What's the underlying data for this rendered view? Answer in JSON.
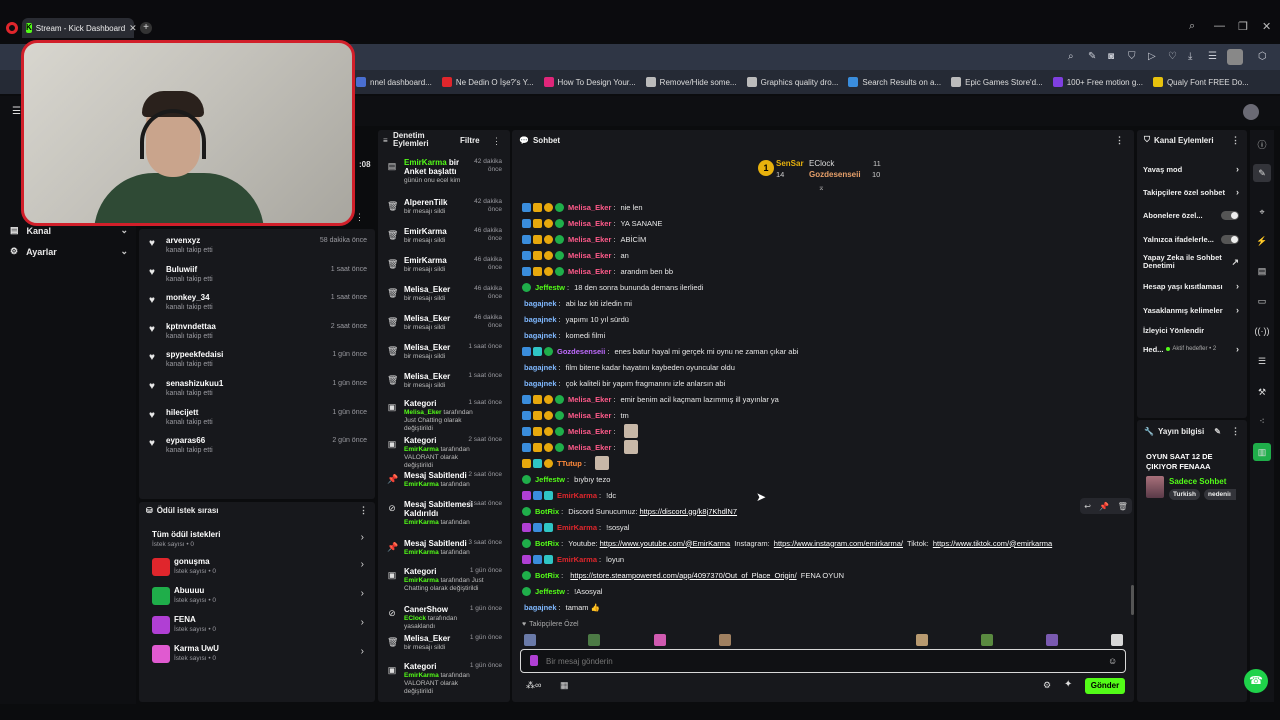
{
  "browser": {
    "tab_title": "Stream - Kick Dashboard",
    "tab_favicon": "K",
    "bookmarks": [
      {
        "label": "nnel dashboard...",
        "color": "#4a6fd1"
      },
      {
        "label": "Ne Dedin O İşe?'s Y...",
        "color": "#e0262c"
      },
      {
        "label": "How To Design Your...",
        "color": "#e0267a"
      },
      {
        "label": "Remove/Hide some...",
        "color": "#bbbbbb"
      },
      {
        "label": "Graphics quality dro...",
        "color": "#bbbbbb"
      },
      {
        "label": "Search Results on a...",
        "color": "#3a8ddc"
      },
      {
        "label": "Epic Games Store'd...",
        "color": "#bbbbbb"
      },
      {
        "label": "100+ Free motion g...",
        "color": "#7f3fe0"
      },
      {
        "label": "Qualy Font FREE Do...",
        "color": "#e7c20d"
      }
    ]
  },
  "sidenav": {
    "time_partial": ":08",
    "items": [
      {
        "label": "Kanal"
      },
      {
        "label": "Ayarlar"
      }
    ]
  },
  "follows": [
    {
      "name": "arvenxyz",
      "sub": "kanalı takip etti",
      "time": "58 dakika önce"
    },
    {
      "name": "Buluwiif",
      "sub": "kanalı takip etti",
      "time": "1 saat önce"
    },
    {
      "name": "monkey_34",
      "sub": "kanalı takip etti",
      "time": "1 saat önce"
    },
    {
      "name": "kptnvndettaa",
      "sub": "kanalı takip etti",
      "time": "2 saat önce"
    },
    {
      "name": "spypeekfedaisi",
      "sub": "kanalı takip etti",
      "time": "1 gün önce"
    },
    {
      "name": "senashizukuu1",
      "sub": "kanalı takip etti",
      "time": "1 gün önce"
    },
    {
      "name": "hilecijett",
      "sub": "kanalı takip etti",
      "time": "1 gün önce"
    },
    {
      "name": "eyparas66",
      "sub": "kanalı takip etti",
      "time": "2 gün önce"
    }
  ],
  "rewards": {
    "title": "Ödül istek sırası",
    "all_label": "Tüm ödül istekleri",
    "all_sub": "İstek sayısı • 0",
    "items": [
      {
        "name": "gonuşma",
        "sub": "İstek sayısı • 0",
        "color": "#e0262c"
      },
      {
        "name": "Abuuuu",
        "sub": "İstek sayısı • 0",
        "color": "#1fae4a"
      },
      {
        "name": "FENA",
        "sub": "İstek sayısı • 0",
        "color": "#b03fd4"
      },
      {
        "name": "Karma UwU",
        "sub": "İstek sayısı • 0",
        "color": "#e05ad0"
      }
    ]
  },
  "moderation": {
    "title": "Denetim Eylemleri",
    "filter": "Filtre",
    "items": [
      {
        "icon": "poll-icon",
        "title_g": "EmirKarma",
        "title": "bir Anket başlattı",
        "desc": "günün onu ecel kim",
        "time": "42 dakika önce"
      },
      {
        "icon": "trash-icon",
        "title": "AlperenTilk",
        "desc": "bir mesajı sildi",
        "time": "42 dakika önce"
      },
      {
        "icon": "trash-icon",
        "title": "EmirKarma",
        "desc": "bir mesajı sildi",
        "time": "46 dakika önce"
      },
      {
        "icon": "trash-icon",
        "title": "EmirKarma",
        "desc": "bir mesajı sildi",
        "time": "46 dakika önce"
      },
      {
        "icon": "trash-icon",
        "title": "Melisa_Eker",
        "desc": "bir mesajı sildi",
        "time": "46 dakika önce"
      },
      {
        "icon": "trash-icon",
        "title": "Melisa_Eker",
        "desc": "bir mesajı sildi",
        "time": "46 dakika önce"
      },
      {
        "icon": "trash-icon",
        "title": "Melisa_Eker",
        "desc": "bir mesajı sildi",
        "time": "1 saat önce"
      },
      {
        "icon": "trash-icon",
        "title": "Melisa_Eker",
        "desc": "bir mesajı sildi",
        "time": "1 saat önce"
      },
      {
        "icon": "category-icon",
        "title": "Kategori",
        "desc_g": "Melisa_Eker",
        "desc": "tarafından Just Chatting olarak değiştirildi",
        "time": "1 saat önce"
      },
      {
        "icon": "category-icon",
        "title": "Kategori",
        "desc_g": "EmirKarma",
        "desc": "tarafından VALORANT olarak değiştirildi",
        "time": "2 saat önce"
      },
      {
        "icon": "pin-icon",
        "title": "Mesaj Sabitlendi",
        "desc_g": "EmirKarma",
        "desc": "tarafından",
        "time": "2 saat önce"
      },
      {
        "icon": "unpin-icon",
        "title": "Mesaj Sabitlemesi Kaldırıldı",
        "desc_g": "EmirKarma",
        "desc": "tarafından",
        "time": "2 saat önce"
      },
      {
        "icon": "pin-icon",
        "title": "Mesaj Sabitlendi",
        "desc_g": "EmirKarma",
        "desc": "tarafından",
        "time": "3 saat önce"
      },
      {
        "icon": "category-icon",
        "title": "Kategori",
        "desc_g": "EmirKarma",
        "desc": "tarafından Just Chatting olarak değiştirildi",
        "time": "1 gün önce"
      },
      {
        "icon": "ban-icon",
        "title": "CanerShow",
        "desc_g": "EClock",
        "desc": "tarafından yasaklandı",
        "time": "1 gün önce"
      },
      {
        "icon": "trash-icon",
        "title": "Melisa_Eker",
        "desc": "bir mesajı sildi",
        "time": "1 gün önce"
      },
      {
        "icon": "category-icon",
        "title": "Kategori",
        "desc_g": "EmirKarma",
        "desc": "tarafından VALORANT olarak değiştirildi",
        "time": "1 gün önce"
      }
    ]
  },
  "chat": {
    "title": "Sohbet",
    "leaderboard": {
      "first_name": "SenSar",
      "first_count": "14",
      "second_name": "EClock",
      "second_count": "11",
      "third_name": "Gozdesenseii",
      "third_count": "10"
    },
    "messages": [
      {
        "badges": [
          "b-blue",
          "b-gold",
          "b-gold b-round",
          "b-green b-round"
        ],
        "user": "Melisa_Eker",
        "color": "#ff5a8a",
        "text": "nie len"
      },
      {
        "badges": [
          "b-blue",
          "b-gold",
          "b-gold b-round",
          "b-green b-round"
        ],
        "user": "Melisa_Eker",
        "color": "#ff5a8a",
        "text": "YA SANANE"
      },
      {
        "badges": [
          "b-blue",
          "b-gold",
          "b-gold b-round",
          "b-green b-round"
        ],
        "user": "Melisa_Eker",
        "color": "#ff5a8a",
        "text": "ABİCİM"
      },
      {
        "badges": [
          "b-blue",
          "b-gold",
          "b-gold b-round",
          "b-green b-round"
        ],
        "user": "Melisa_Eker",
        "color": "#ff5a8a",
        "text": "an"
      },
      {
        "badges": [
          "b-blue",
          "b-gold",
          "b-gold b-round",
          "b-green b-round"
        ],
        "user": "Melisa_Eker",
        "color": "#ff5a8a",
        "text": "arandım ben bb"
      },
      {
        "badges": [
          "b-green b-round"
        ],
        "user": "Jeffestw",
        "color": "#53fc18",
        "text": "18 den sonra bununda demans ilerliedi"
      },
      {
        "badges": [],
        "user": "bagajnek",
        "color": "#7fb8ff",
        "text": "abi laz kiti izledin mi"
      },
      {
        "badges": [],
        "user": "bagajnek",
        "color": "#7fb8ff",
        "text": "yapımı 10 yıl sürdü"
      },
      {
        "badges": [],
        "user": "bagajnek",
        "color": "#7fb8ff",
        "text": "komedi filmi"
      },
      {
        "badges": [
          "b-blue",
          "b-teal",
          "b-green b-round"
        ],
        "user": "Gozdesenseii",
        "color": "#c06bff",
        "text": "enes batur hayal mi gerçek mi oynu ne zaman çıkar abi"
      },
      {
        "badges": [],
        "user": "bagajnek",
        "color": "#7fb8ff",
        "text": "film bitene kadar hayatını kaybeden oyuncular oldu"
      },
      {
        "badges": [],
        "user": "bagajnek",
        "color": "#7fb8ff",
        "text": "çok kaliteli bir yapım fragmanını izle anlarsın abi"
      },
      {
        "badges": [
          "b-blue",
          "b-gold",
          "b-gold b-round",
          "b-green b-round"
        ],
        "user": "Melisa_Eker",
        "color": "#ff5a8a",
        "text": "emir benim acil kaçmam lazımmış ill yayınlar ya"
      },
      {
        "badges": [
          "b-blue",
          "b-gold",
          "b-gold b-round",
          "b-green b-round"
        ],
        "user": "Melisa_Eker",
        "color": "#ff5a8a",
        "text": "tm"
      },
      {
        "badges": [
          "b-blue",
          "b-gold",
          "b-gold b-round",
          "b-green b-round"
        ],
        "user": "Melisa_Eker",
        "color": "#ff5a8a",
        "text": ""
      },
      {
        "badges": [
          "b-blue",
          "b-gold",
          "b-gold b-round",
          "b-green b-round"
        ],
        "user": "Melisa_Eker",
        "color": "#ff5a8a",
        "text": ""
      },
      {
        "badges": [
          "b-gold",
          "b-teal",
          "b-gold b-round"
        ],
        "user": "TTutup",
        "color": "#ff8a3a",
        "text": ""
      },
      {
        "badges": [
          "b-green b-round"
        ],
        "user": "Jeffestw",
        "color": "#53fc18",
        "text": "bıybıy tezo"
      },
      {
        "badges": [
          "b-purple",
          "b-blue",
          "b-teal"
        ],
        "user": "EmirKarma",
        "color": "#e0262c",
        "text": "!dc"
      },
      {
        "badges": [
          "b-green b-round"
        ],
        "user": "BotRix",
        "color": "#53fc18",
        "text": "Discord Sunucumuz: ",
        "link": "https://discord.gg/k8j7KhdlN7"
      },
      {
        "badges": [
          "b-purple",
          "b-blue",
          "b-teal"
        ],
        "user": "EmirKarma",
        "color": "#e0262c",
        "text": "!sosyal"
      },
      {
        "badges": [
          "b-green b-round"
        ],
        "user": "BotRix",
        "color": "#53fc18",
        "text": "Youtube: ",
        "link": "https://www.youtube.com/@EmirKarma",
        "text2": " Instagram: ",
        "link2": "https://www.instagram.com/emirkarma/",
        "text3": " Tiktok: ",
        "link3": "https://www.tiktok.com/@emirkarma"
      },
      {
        "badges": [
          "b-purple",
          "b-blue",
          "b-teal"
        ],
        "user": "EmirKarma",
        "color": "#e0262c",
        "text": "loyun"
      },
      {
        "badges": [
          "b-green b-round"
        ],
        "user": "BotRix",
        "color": "#53fc18",
        "text": "",
        "link": "https://store.steampowered.com/app/4097370/Out_of_Place_Origin/",
        "text2": " FENA OYUN"
      },
      {
        "badges": [
          "b-green b-round"
        ],
        "user": "Jeffestw",
        "color": "#53fc18",
        "text": "!Asosyal"
      },
      {
        "badges": [],
        "user": "bagajnek",
        "color": "#7fb8ff",
        "text": "tamam 👍"
      }
    ],
    "followers_only_label": "Takipçilere Özel",
    "input_placeholder": "Bir mesaj gönderin",
    "send_label": "Gönder"
  },
  "channel_actions": {
    "title": "Kanal Eylemleri",
    "rows": [
      {
        "label": "Yavaş mod",
        "kind": "chevron"
      },
      {
        "label": "Takipçilere özel sohbet",
        "kind": "chevron"
      },
      {
        "label": "Abonelere özel...",
        "kind": "toggle"
      },
      {
        "label": "Yalnızca ifadelerle...",
        "kind": "toggle"
      },
      {
        "label": "Yapay Zeka ile Sohbet Denetimi",
        "kind": "ext"
      },
      {
        "label": "Hesap yaşı kısıtlaması",
        "kind": "chevron"
      },
      {
        "label": "Yasaklanmış kelimeler",
        "kind": "chevron"
      },
      {
        "label": "İzleyici Yönlendir",
        "kind": "none"
      },
      {
        "label": "Hed...",
        "kind": "chevron",
        "extra": "Aktif hedefler • 2"
      }
    ]
  },
  "stream_info": {
    "title": "Yayın bilgisi",
    "stream_title": "OYUN SAAT 12 DE ÇIKIYOR FENAAA ",
    "category": "Sadece Sohbet",
    "tags": [
      "Turkish",
      "nedeniı"
    ]
  }
}
